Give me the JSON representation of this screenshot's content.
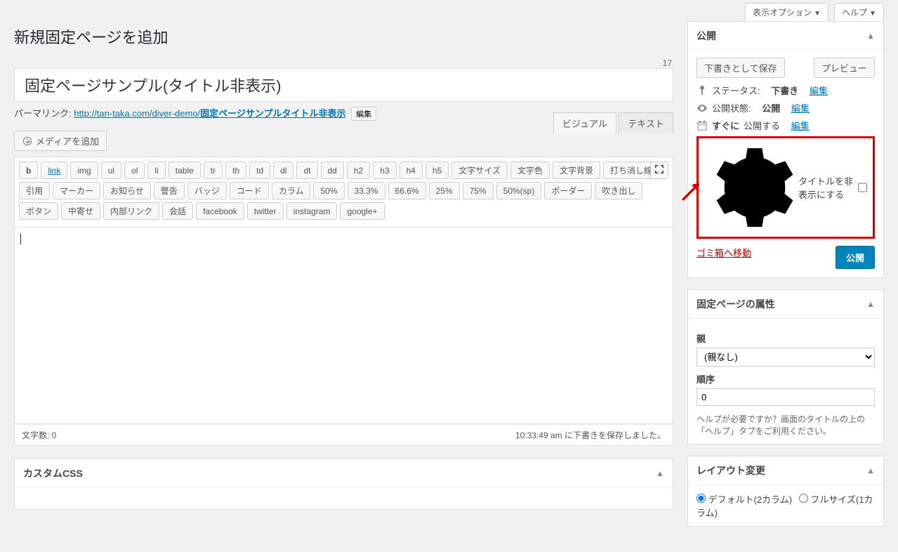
{
  "topTabs": {
    "displayOptions": "表示オプション",
    "help": "ヘルプ"
  },
  "pageTitle": "新規固定ページを追加",
  "revisionCount": "17",
  "titleValue": "固定ページサンプル(タイトル非表示)",
  "permalink": {
    "label": "パーマリンク:",
    "base": "http://tan-taka.com/diver-demo/",
    "slug": "固定ページサンプルタイトル非表示",
    "edit": "編集"
  },
  "addMedia": "メディアを追加",
  "editorTabs": {
    "visual": "ビジュアル",
    "text": "テキスト"
  },
  "toolbar": {
    "row1": [
      "b",
      "link",
      "img",
      "ul",
      "ol",
      "li",
      "table",
      "tr",
      "th",
      "td",
      "dl",
      "dt",
      "dd",
      "h2",
      "h3",
      "h4",
      "h5",
      "文字サイズ",
      "文字色",
      "文字背景",
      "打ち消し線"
    ],
    "row2": [
      "引用",
      "マーカー",
      "お知らせ",
      "警告",
      "バッジ",
      "コード",
      "カラム",
      "50%",
      "33.3%",
      "66.6%",
      "25%",
      "75%",
      "50%(sp)",
      "ボーダー",
      "吹き出し"
    ],
    "row3": [
      "ボタン",
      "中寄せ",
      "内部リンク",
      "会話",
      "facebook",
      "twitter",
      "instagram",
      "google+"
    ]
  },
  "statusBar": {
    "wordCount": "文字数: 0",
    "saved": "10:33:49 am に下書きを保存しました。"
  },
  "customCSS": {
    "title": "カスタムCSS"
  },
  "publish": {
    "boxTitle": "公開",
    "saveDraft": "下書きとして保存",
    "preview": "プレビュー",
    "statusLabel": "ステータス:",
    "statusValue": "下書き",
    "statusEdit": "編集",
    "visibilityLabel": "公開状態:",
    "visibilityValue": "公開",
    "visibilityEdit": "編集",
    "schedulePrefix": "すぐに",
    "scheduleSuffix": "公開する",
    "scheduleEdit": "編集",
    "hideTitleLabel": "タイトルを非表示にする",
    "trash": "ゴミ箱へ移動",
    "publishBtn": "公開"
  },
  "pageAttrs": {
    "boxTitle": "固定ページの属性",
    "parentLabel": "親",
    "parentSelected": "(親なし)",
    "orderLabel": "順序",
    "orderValue": "0",
    "helpText": "ヘルプが必要ですか？画面のタイトルの上の「ヘルプ」タブをご利用ください。"
  },
  "layout": {
    "boxTitle": "レイアウト変更",
    "option1": "デフォルト(2カラム)",
    "option2": "フルサイズ(1カラム)"
  }
}
